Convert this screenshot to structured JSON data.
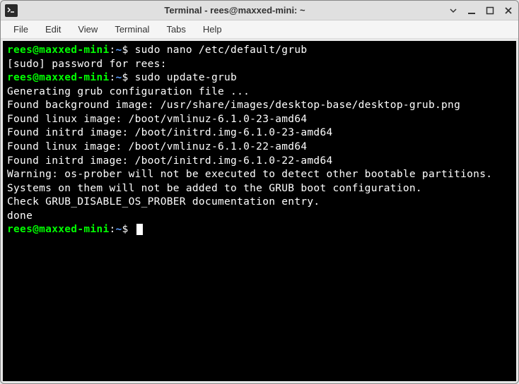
{
  "window": {
    "title": "Terminal - rees@maxxed-mini: ~"
  },
  "menubar": {
    "items": [
      "File",
      "Edit",
      "View",
      "Terminal",
      "Tabs",
      "Help"
    ]
  },
  "prompt": {
    "user_host": "rees@maxxed-mini",
    "path": "~",
    "symbol": "$"
  },
  "session": {
    "cmd1": "sudo nano /etc/default/grub",
    "sudo_prompt": "[sudo] password for rees:",
    "cmd2": "sudo update-grub",
    "output": [
      "Generating grub configuration file ...",
      "Found background image: /usr/share/images/desktop-base/desktop-grub.png",
      "Found linux image: /boot/vmlinuz-6.1.0-23-amd64",
      "Found initrd image: /boot/initrd.img-6.1.0-23-amd64",
      "Found linux image: /boot/vmlinuz-6.1.0-22-amd64",
      "Found initrd image: /boot/initrd.img-6.1.0-22-amd64",
      "Warning: os-prober will not be executed to detect other bootable partitions.",
      "Systems on them will not be added to the GRUB boot configuration.",
      "Check GRUB_DISABLE_OS_PROBER documentation entry.",
      "done"
    ]
  }
}
